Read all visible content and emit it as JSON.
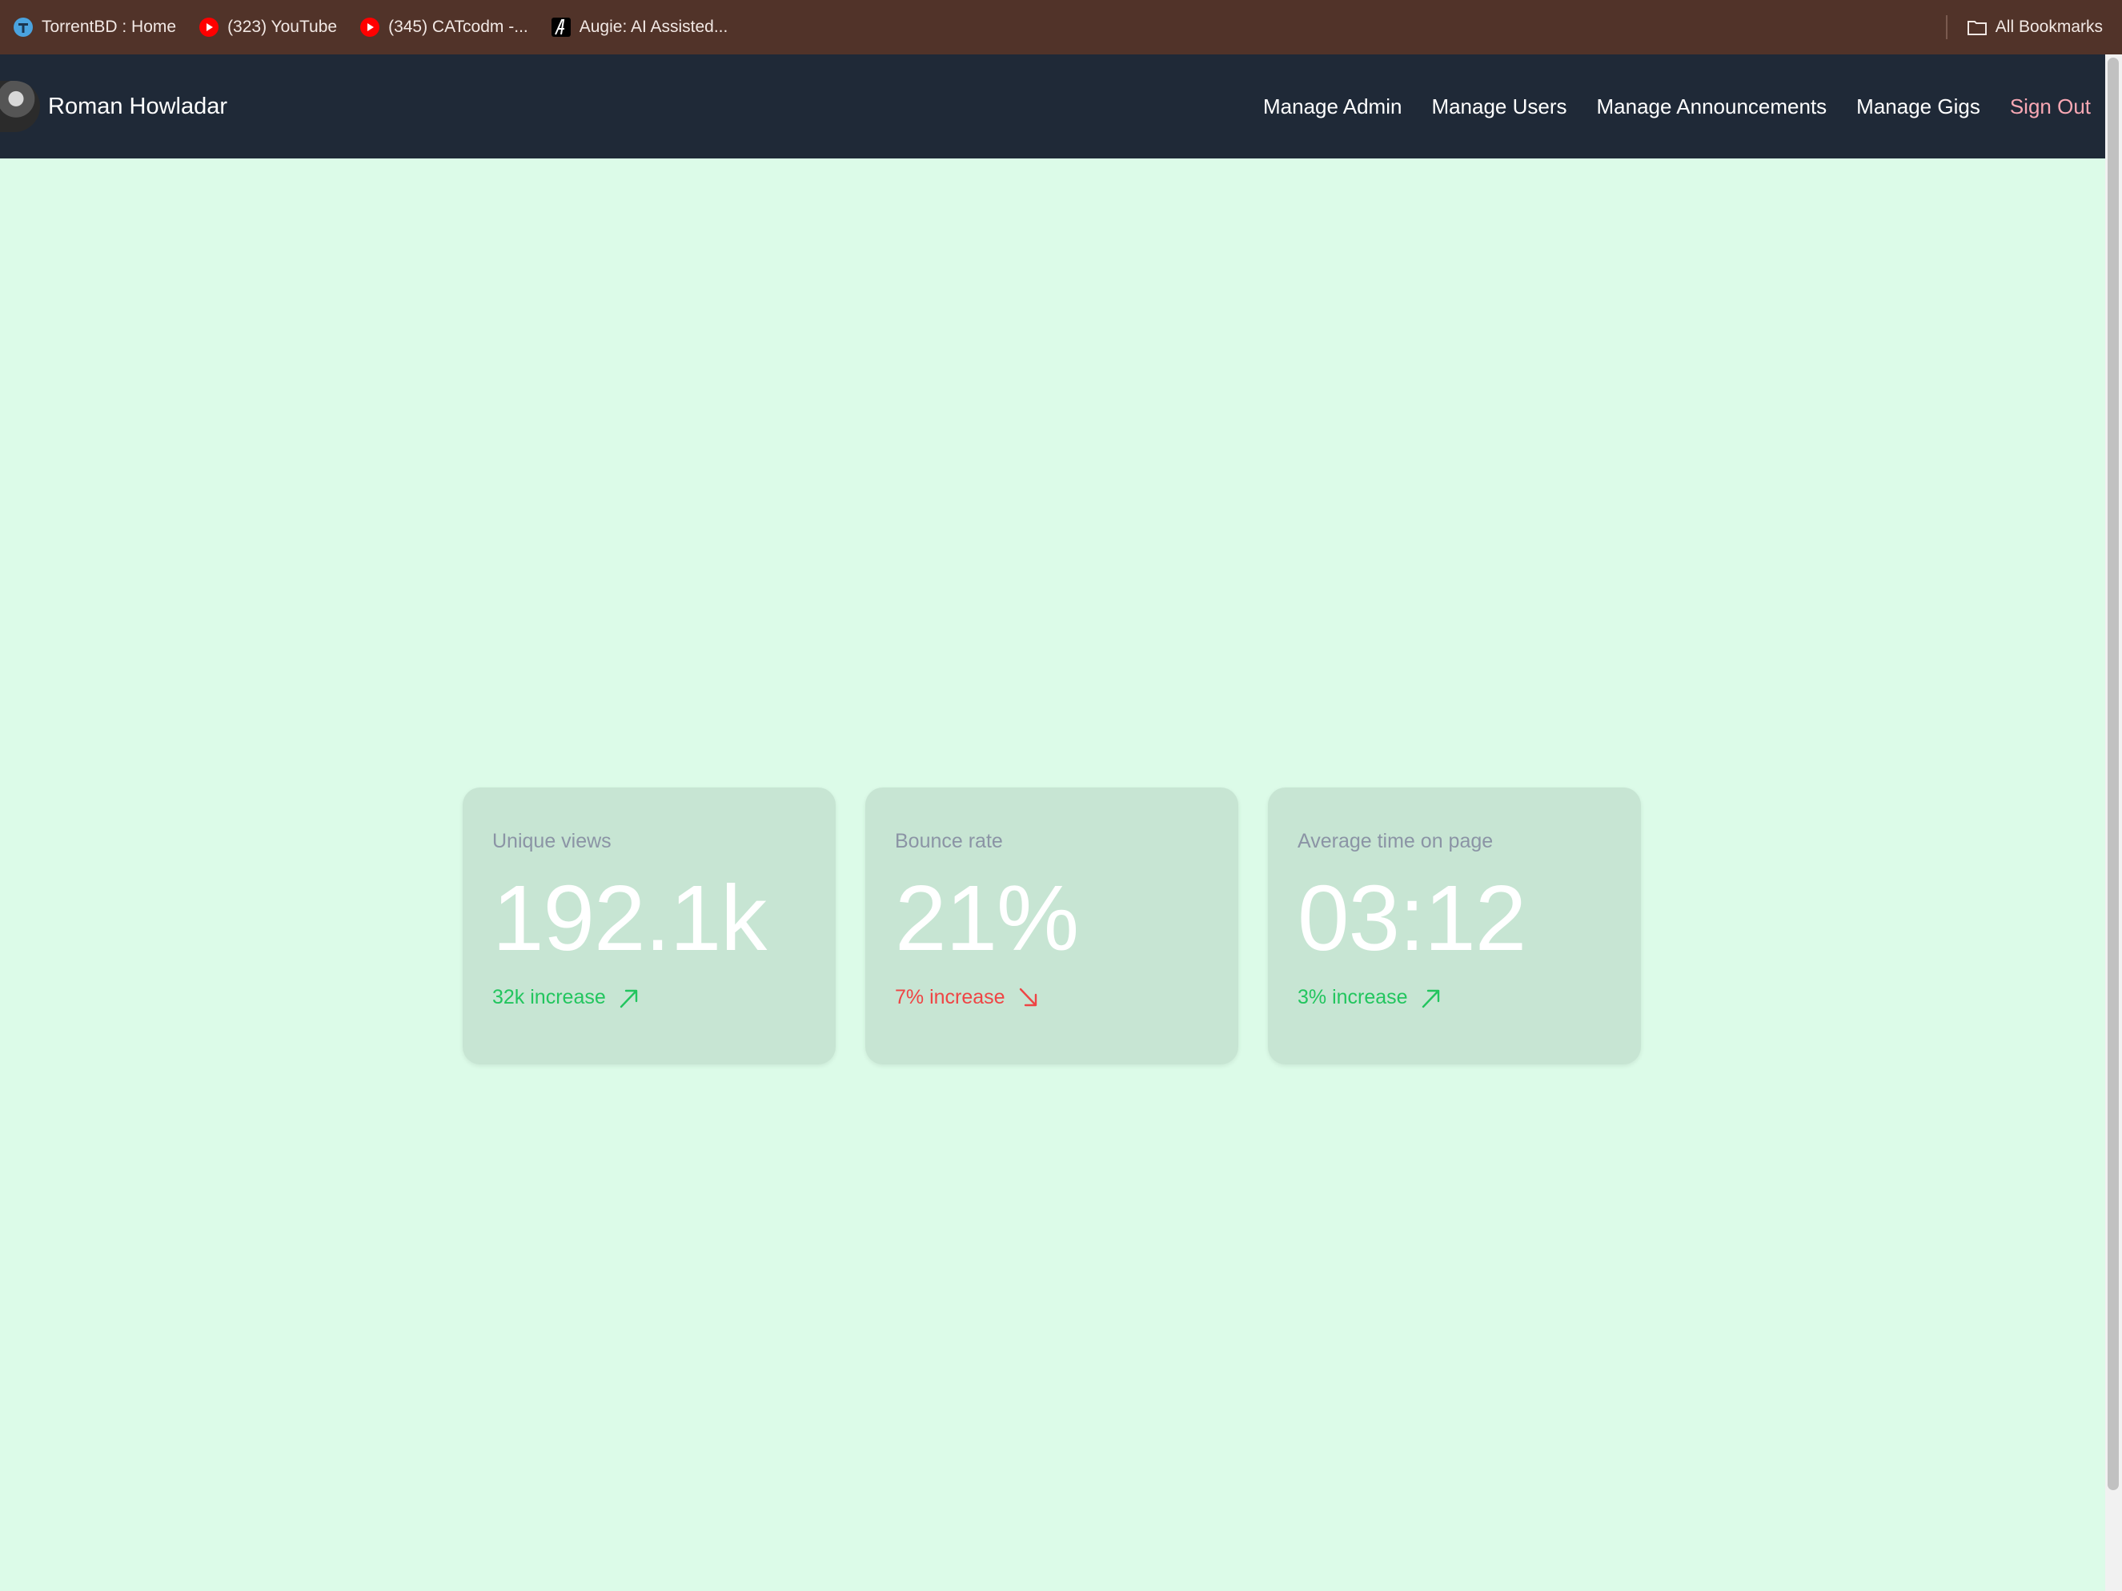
{
  "bookmarks": {
    "items": [
      {
        "label": "TorrentBD : Home",
        "icon": "torrentbd-icon"
      },
      {
        "label": "(323) YouTube",
        "icon": "youtube-icon"
      },
      {
        "label": "(345) CATcodm -...",
        "icon": "youtube-icon"
      },
      {
        "label": "Augie: AI Assisted...",
        "icon": "augie-icon"
      }
    ],
    "all_bookmarks": "All Bookmarks"
  },
  "navbar": {
    "user_name": "Roman Howladar",
    "links": [
      "Manage Admin",
      "Manage Users",
      "Manage Announcements",
      "Manage Gigs"
    ],
    "sign_out": "Sign Out"
  },
  "stats": [
    {
      "label": "Unique views",
      "value": "192.1k",
      "change": "32k increase",
      "trend": "up",
      "color": "#22c55e"
    },
    {
      "label": "Bounce rate",
      "value": "21%",
      "change": "7% increase",
      "trend": "down",
      "color": "#ef4444"
    },
    {
      "label": "Average time on page",
      "value": "03:12",
      "change": "3% increase",
      "trend": "up",
      "color": "#22c55e"
    }
  ],
  "colors": {
    "bookmarks_bg": "#513329",
    "navbar_bg": "#1f2937",
    "page_bg": "#dcfbe8",
    "card_bg": "#c7e5d3",
    "sign_out": "#f9a8b4"
  }
}
